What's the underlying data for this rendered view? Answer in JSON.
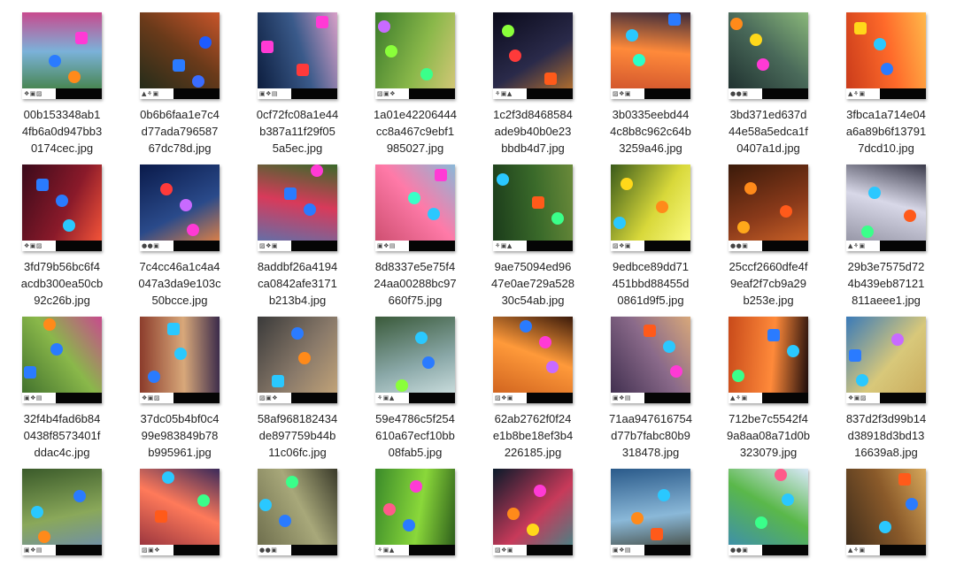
{
  "window": {
    "view": "large-icons-thumbnail-grid"
  },
  "files": [
    {
      "name_lines": [
        "00b153348ab1",
        "4fb6a0d947bb3",
        "0174cec.jpg"
      ],
      "palette": [
        "#3b7a2e",
        "#7bb2d9",
        "#c84a8e"
      ],
      "stickers": [
        {
          "color": "#ff3ad5",
          "shape": "square"
        },
        {
          "color": "#2a7bff",
          "shape": "circle"
        },
        {
          "color": "#ff8a1a",
          "shape": "circle"
        }
      ],
      "glyphs": "❖▣▨"
    },
    {
      "name_lines": [
        "0b6b6faa1e7c4",
        "d77ada796587",
        "67dc78d.jpg"
      ],
      "palette": [
        "#1a2a1a",
        "#6a3a1a",
        "#c8552a"
      ],
      "stickers": [
        {
          "color": "#1e5bff",
          "shape": "circle"
        },
        {
          "color": "#2a7bff",
          "shape": "square"
        },
        {
          "color": "#3a6cff",
          "shape": "circle"
        }
      ],
      "glyphs": "▲⚘▣"
    },
    {
      "name_lines": [
        "0cf72fc08a1e44",
        "b387a11f29f05",
        "5a5ec.jpg"
      ],
      "palette": [
        "#0a1a3a",
        "#3a5a8a",
        "#d8a0c8"
      ],
      "stickers": [
        {
          "color": "#ff3ad5",
          "shape": "square"
        },
        {
          "color": "#ff3a3a",
          "shape": "square"
        },
        {
          "color": "#ff3ad5",
          "shape": "square"
        }
      ],
      "glyphs": "▣❖▤"
    },
    {
      "name_lines": [
        "1a01e42206444",
        "cc8a467c9ebf1",
        "985027.jpg"
      ],
      "palette": [
        "#3a7a2a",
        "#8ab84a",
        "#d8c87a"
      ],
      "stickers": [
        {
          "color": "#8aff3a",
          "shape": "circle"
        },
        {
          "color": "#3aff8a",
          "shape": "circle"
        },
        {
          "color": "#c86aff",
          "shape": "circle"
        }
      ],
      "glyphs": "▨▣❖"
    },
    {
      "name_lines": [
        "1c2f3d8468584",
        "ade9b40b0e23",
        "bbdb4d7.jpg"
      ],
      "palette": [
        "#0a0a1a",
        "#2a2a4a",
        "#c87a2a"
      ],
      "stickers": [
        {
          "color": "#ff3a3a",
          "shape": "circle"
        },
        {
          "color": "#ff5a1a",
          "shape": "square"
        },
        {
          "color": "#8aff3a",
          "shape": "circle"
        }
      ],
      "glyphs": "⚘▣▲"
    },
    {
      "name_lines": [
        "3b0335eebd44",
        "4c8b8c962c64b",
        "3259a46.jpg"
      ],
      "palette": [
        "#c84a2a",
        "#ff8a3a",
        "#3a2a3a"
      ],
      "stickers": [
        {
          "color": "#2affc8",
          "shape": "circle"
        },
        {
          "color": "#2a7bff",
          "shape": "square"
        },
        {
          "color": "#2ac8ff",
          "shape": "circle"
        }
      ],
      "glyphs": "▨❖▣"
    },
    {
      "name_lines": [
        "3bd371ed637d",
        "44e58a5edca1f",
        "0407a1d.jpg"
      ],
      "palette": [
        "#1a2a2a",
        "#4a6a5a",
        "#8ab87a"
      ],
      "stickers": [
        {
          "color": "#ff3ad5",
          "shape": "circle"
        },
        {
          "color": "#ff8a1a",
          "shape": "circle"
        },
        {
          "color": "#ffd81a",
          "shape": "circle"
        }
      ],
      "glyphs": "●●▣"
    },
    {
      "name_lines": [
        "3fbca1a714e04",
        "a6a89b6f13791",
        "7dcd10.jpg"
      ],
      "palette": [
        "#c83a1a",
        "#ff6a2a",
        "#ffb84a"
      ],
      "stickers": [
        {
          "color": "#2a7bff",
          "shape": "circle"
        },
        {
          "color": "#ffd81a",
          "shape": "square"
        },
        {
          "color": "#2ac8ff",
          "shape": "circle"
        }
      ],
      "glyphs": "▲⚘▣"
    },
    {
      "name_lines": [
        "3fd79b56bc6f4",
        "acdb300ea50cb",
        "92c26b.jpg"
      ],
      "palette": [
        "#3a0a1a",
        "#8a1a2a",
        "#ff5a3a"
      ],
      "stickers": [
        {
          "color": "#2ac8ff",
          "shape": "circle"
        },
        {
          "color": "#2a7bff",
          "shape": "square"
        },
        {
          "color": "#2a7bff",
          "shape": "circle"
        }
      ],
      "glyphs": "❖▣▨"
    },
    {
      "name_lines": [
        "7c4cc46a1c4a4",
        "047a3da9e103c",
        "50bcce.jpg"
      ],
      "palette": [
        "#0a1a4a",
        "#2a4a8a",
        "#ff8a3a"
      ],
      "stickers": [
        {
          "color": "#ff3ad5",
          "shape": "circle"
        },
        {
          "color": "#ff3a3a",
          "shape": "circle"
        },
        {
          "color": "#c86aff",
          "shape": "circle"
        }
      ],
      "glyphs": "●●▣"
    },
    {
      "name_lines": [
        "8addbf26a4194",
        "ca0842afe3171",
        "b213b4.jpg"
      ],
      "palette": [
        "#4a7ab8",
        "#d83a5a",
        "#3a6a2a"
      ],
      "stickers": [
        {
          "color": "#ff3ad5",
          "shape": "circle"
        },
        {
          "color": "#2a7bff",
          "shape": "square"
        },
        {
          "color": "#2a7bff",
          "shape": "circle"
        }
      ],
      "glyphs": "▨❖▣"
    },
    {
      "name_lines": [
        "8d8337e5e75f4",
        "24aa00288bc97",
        "660f75.jpg"
      ],
      "palette": [
        "#c84a6a",
        "#ff7aa8",
        "#8ab8d8"
      ],
      "stickers": [
        {
          "color": "#ff3ad5",
          "shape": "square"
        },
        {
          "color": "#3affc8",
          "shape": "circle"
        },
        {
          "color": "#2ac8ff",
          "shape": "circle"
        }
      ],
      "glyphs": "▣❖▤"
    },
    {
      "name_lines": [
        "9ae75094ed96",
        "47e0ae729a528",
        "30c54ab.jpg"
      ],
      "palette": [
        "#1a3a1a",
        "#3a6a2a",
        "#6a8a3a"
      ],
      "stickers": [
        {
          "color": "#2ac8ff",
          "shape": "circle"
        },
        {
          "color": "#ff5a1a",
          "shape": "square"
        },
        {
          "color": "#3aff8a",
          "shape": "circle"
        }
      ],
      "glyphs": "⚘▣▲"
    },
    {
      "name_lines": [
        "9edbce89dd71",
        "451bbd88455d",
        "0861d9f5.jpg"
      ],
      "palette": [
        "#3a5a1a",
        "#d8d83a",
        "#ffff8a"
      ],
      "stickers": [
        {
          "color": "#ffd81a",
          "shape": "circle"
        },
        {
          "color": "#ff8a1a",
          "shape": "circle"
        },
        {
          "color": "#2ac8ff",
          "shape": "circle"
        }
      ],
      "glyphs": "▨❖▣"
    },
    {
      "name_lines": [
        "25ccf2660dfe4f",
        "9eaf2f7cb9a29",
        "b253e.jpg"
      ],
      "palette": [
        "#3a1a0a",
        "#8a3a1a",
        "#d86a2a"
      ],
      "stickers": [
        {
          "color": "#ff8a1a",
          "shape": "circle"
        },
        {
          "color": "#ff5a1a",
          "shape": "circle"
        },
        {
          "color": "#ffa81a",
          "shape": "circle"
        }
      ],
      "glyphs": "●●▣"
    },
    {
      "name_lines": [
        "29b3e7575d72",
        "4b439eb87121",
        "811aeee1.jpg"
      ],
      "palette": [
        "#8a8a9a",
        "#d8d8e8",
        "#3a3a4a"
      ],
      "stickers": [
        {
          "color": "#2ac8ff",
          "shape": "circle"
        },
        {
          "color": "#ff5a1a",
          "shape": "circle"
        },
        {
          "color": "#3aff8a",
          "shape": "circle"
        }
      ],
      "glyphs": "▲⚘▣"
    },
    {
      "name_lines": [
        "32f4b4fad6b84",
        "0438f8573401f",
        "ddac4c.jpg"
      ],
      "palette": [
        "#3a6a2a",
        "#8ab84a",
        "#c84a8e"
      ],
      "stickers": [
        {
          "color": "#2a7bff",
          "shape": "circle"
        },
        {
          "color": "#2a7bff",
          "shape": "square"
        },
        {
          "color": "#ff8a1a",
          "shape": "circle"
        }
      ],
      "glyphs": "▣❖▤"
    },
    {
      "name_lines": [
        "37dc05b4bf0c4",
        "99e983849b78",
        "b995961.jpg"
      ],
      "palette": [
        "#8a3a2a",
        "#d8a87a",
        "#3a2a4a"
      ],
      "stickers": [
        {
          "color": "#2ac8ff",
          "shape": "circle"
        },
        {
          "color": "#2a7bff",
          "shape": "circle"
        },
        {
          "color": "#2ac8ff",
          "shape": "square"
        }
      ],
      "glyphs": "❖▣▨"
    },
    {
      "name_lines": [
        "58af968182434",
        "de897759b44b",
        "11c06fc.jpg"
      ],
      "palette": [
        "#3a3a3a",
        "#8a7a6a",
        "#c8a87a"
      ],
      "stickers": [
        {
          "color": "#ff8a1a",
          "shape": "circle"
        },
        {
          "color": "#2ac8ff",
          "shape": "square"
        },
        {
          "color": "#2a7bff",
          "shape": "circle"
        }
      ],
      "glyphs": "▨▣❖"
    },
    {
      "name_lines": [
        "59e4786c5f254",
        "610a67ecf10bb",
        "08fab5.jpg"
      ],
      "palette": [
        "#3a5a3a",
        "#8aa8a8",
        "#d8e8e8"
      ],
      "stickers": [
        {
          "color": "#2a7bff",
          "shape": "circle"
        },
        {
          "color": "#8aff3a",
          "shape": "circle"
        },
        {
          "color": "#2ac8ff",
          "shape": "circle"
        }
      ],
      "glyphs": "⚘▣▲"
    },
    {
      "name_lines": [
        "62ab2762f0f24",
        "e1b8be18ef3b4",
        "226185.jpg"
      ],
      "palette": [
        "#c85a1a",
        "#ff9a3a",
        "#3a1a0a"
      ],
      "stickers": [
        {
          "color": "#c86aff",
          "shape": "circle"
        },
        {
          "color": "#2a7bff",
          "shape": "circle"
        },
        {
          "color": "#ff3ad5",
          "shape": "circle"
        }
      ],
      "glyphs": "▨❖▣"
    },
    {
      "name_lines": [
        "71aa947616754",
        "d77b7fabc80b9",
        "318478.jpg"
      ],
      "palette": [
        "#3a2a4a",
        "#8a6a8a",
        "#d8a87a"
      ],
      "stickers": [
        {
          "color": "#ff3ad5",
          "shape": "circle"
        },
        {
          "color": "#ff5a1a",
          "shape": "square"
        },
        {
          "color": "#2ac8ff",
          "shape": "circle"
        }
      ],
      "glyphs": "▣❖▤"
    },
    {
      "name_lines": [
        "712be7c5542f4",
        "9a8aa08a71d0b",
        "323079.jpg"
      ],
      "palette": [
        "#c84a1a",
        "#ff8a3a",
        "#1a0a0a"
      ],
      "stickers": [
        {
          "color": "#3aff8a",
          "shape": "circle"
        },
        {
          "color": "#2a7bff",
          "shape": "square"
        },
        {
          "color": "#2ac8ff",
          "shape": "circle"
        }
      ],
      "glyphs": "▲⚘▣"
    },
    {
      "name_lines": [
        "837d2f3d99b14",
        "d38918d3bd13",
        "16639a8.jpg"
      ],
      "palette": [
        "#3a7ab8",
        "#d8c87a",
        "#c8a85a"
      ],
      "stickers": [
        {
          "color": "#2ac8ff",
          "shape": "circle"
        },
        {
          "color": "#c86aff",
          "shape": "circle"
        },
        {
          "color": "#2a7bff",
          "shape": "square"
        }
      ],
      "glyphs": "❖▣▨"
    },
    {
      "name_lines": [],
      "palette": [
        "#3a5a2a",
        "#8aa85a",
        "#6a8ab8"
      ],
      "stickers": [
        {
          "color": "#ff8a1a",
          "shape": "circle"
        },
        {
          "color": "#2a7bff",
          "shape": "circle"
        },
        {
          "color": "#2ac8ff",
          "shape": "circle"
        }
      ],
      "glyphs": "▣❖▤"
    },
    {
      "name_lines": [],
      "palette": [
        "#8a2a3a",
        "#ff7a5a",
        "#3a2a5a"
      ],
      "stickers": [
        {
          "color": "#2ac8ff",
          "shape": "circle"
        },
        {
          "color": "#3aff8a",
          "shape": "circle"
        },
        {
          "color": "#ff5a1a",
          "shape": "square"
        }
      ],
      "glyphs": "▨▣❖"
    },
    {
      "name_lines": [],
      "palette": [
        "#6a6a4a",
        "#a8a87a",
        "#3a3a2a"
      ],
      "stickers": [
        {
          "color": "#3aff8a",
          "shape": "circle"
        },
        {
          "color": "#2ac8ff",
          "shape": "circle"
        },
        {
          "color": "#2a7bff",
          "shape": "circle"
        }
      ],
      "glyphs": "●●▣"
    },
    {
      "name_lines": [],
      "palette": [
        "#3a8a2a",
        "#8ad83a",
        "#2a5a1a"
      ],
      "stickers": [
        {
          "color": "#ff3ad5",
          "shape": "circle"
        },
        {
          "color": "#ff5a8a",
          "shape": "circle"
        },
        {
          "color": "#2a7bff",
          "shape": "circle"
        }
      ],
      "glyphs": "⚘▣▲"
    },
    {
      "name_lines": [],
      "palette": [
        "#0a1a2a",
        "#c83a5a",
        "#3a8a8a"
      ],
      "stickers": [
        {
          "color": "#ff3ad5",
          "shape": "circle"
        },
        {
          "color": "#ff8a1a",
          "shape": "circle"
        },
        {
          "color": "#ffd81a",
          "shape": "circle"
        }
      ],
      "glyphs": "▨❖▣"
    },
    {
      "name_lines": [],
      "palette": [
        "#2a5a8a",
        "#8ab8d8",
        "#3a3a2a"
      ],
      "stickers": [
        {
          "color": "#2ac8ff",
          "shape": "circle"
        },
        {
          "color": "#ff8a1a",
          "shape": "circle"
        },
        {
          "color": "#ff5a1a",
          "shape": "square"
        }
      ],
      "glyphs": "▣❖▤"
    },
    {
      "name_lines": [],
      "palette": [
        "#3a8ab8",
        "#5ab84a",
        "#d8e8f8"
      ],
      "stickers": [
        {
          "color": "#2ac8ff",
          "shape": "circle"
        },
        {
          "color": "#3aff8a",
          "shape": "circle"
        },
        {
          "color": "#ff5a8a",
          "shape": "circle"
        }
      ],
      "glyphs": "●●▣"
    },
    {
      "name_lines": [],
      "palette": [
        "#3a2a1a",
        "#8a5a2a",
        "#d8a85a"
      ],
      "stickers": [
        {
          "color": "#2a7bff",
          "shape": "circle"
        },
        {
          "color": "#2ac8ff",
          "shape": "circle"
        },
        {
          "color": "#ff5a1a",
          "shape": "square"
        }
      ],
      "glyphs": "▲⚘▣"
    }
  ]
}
